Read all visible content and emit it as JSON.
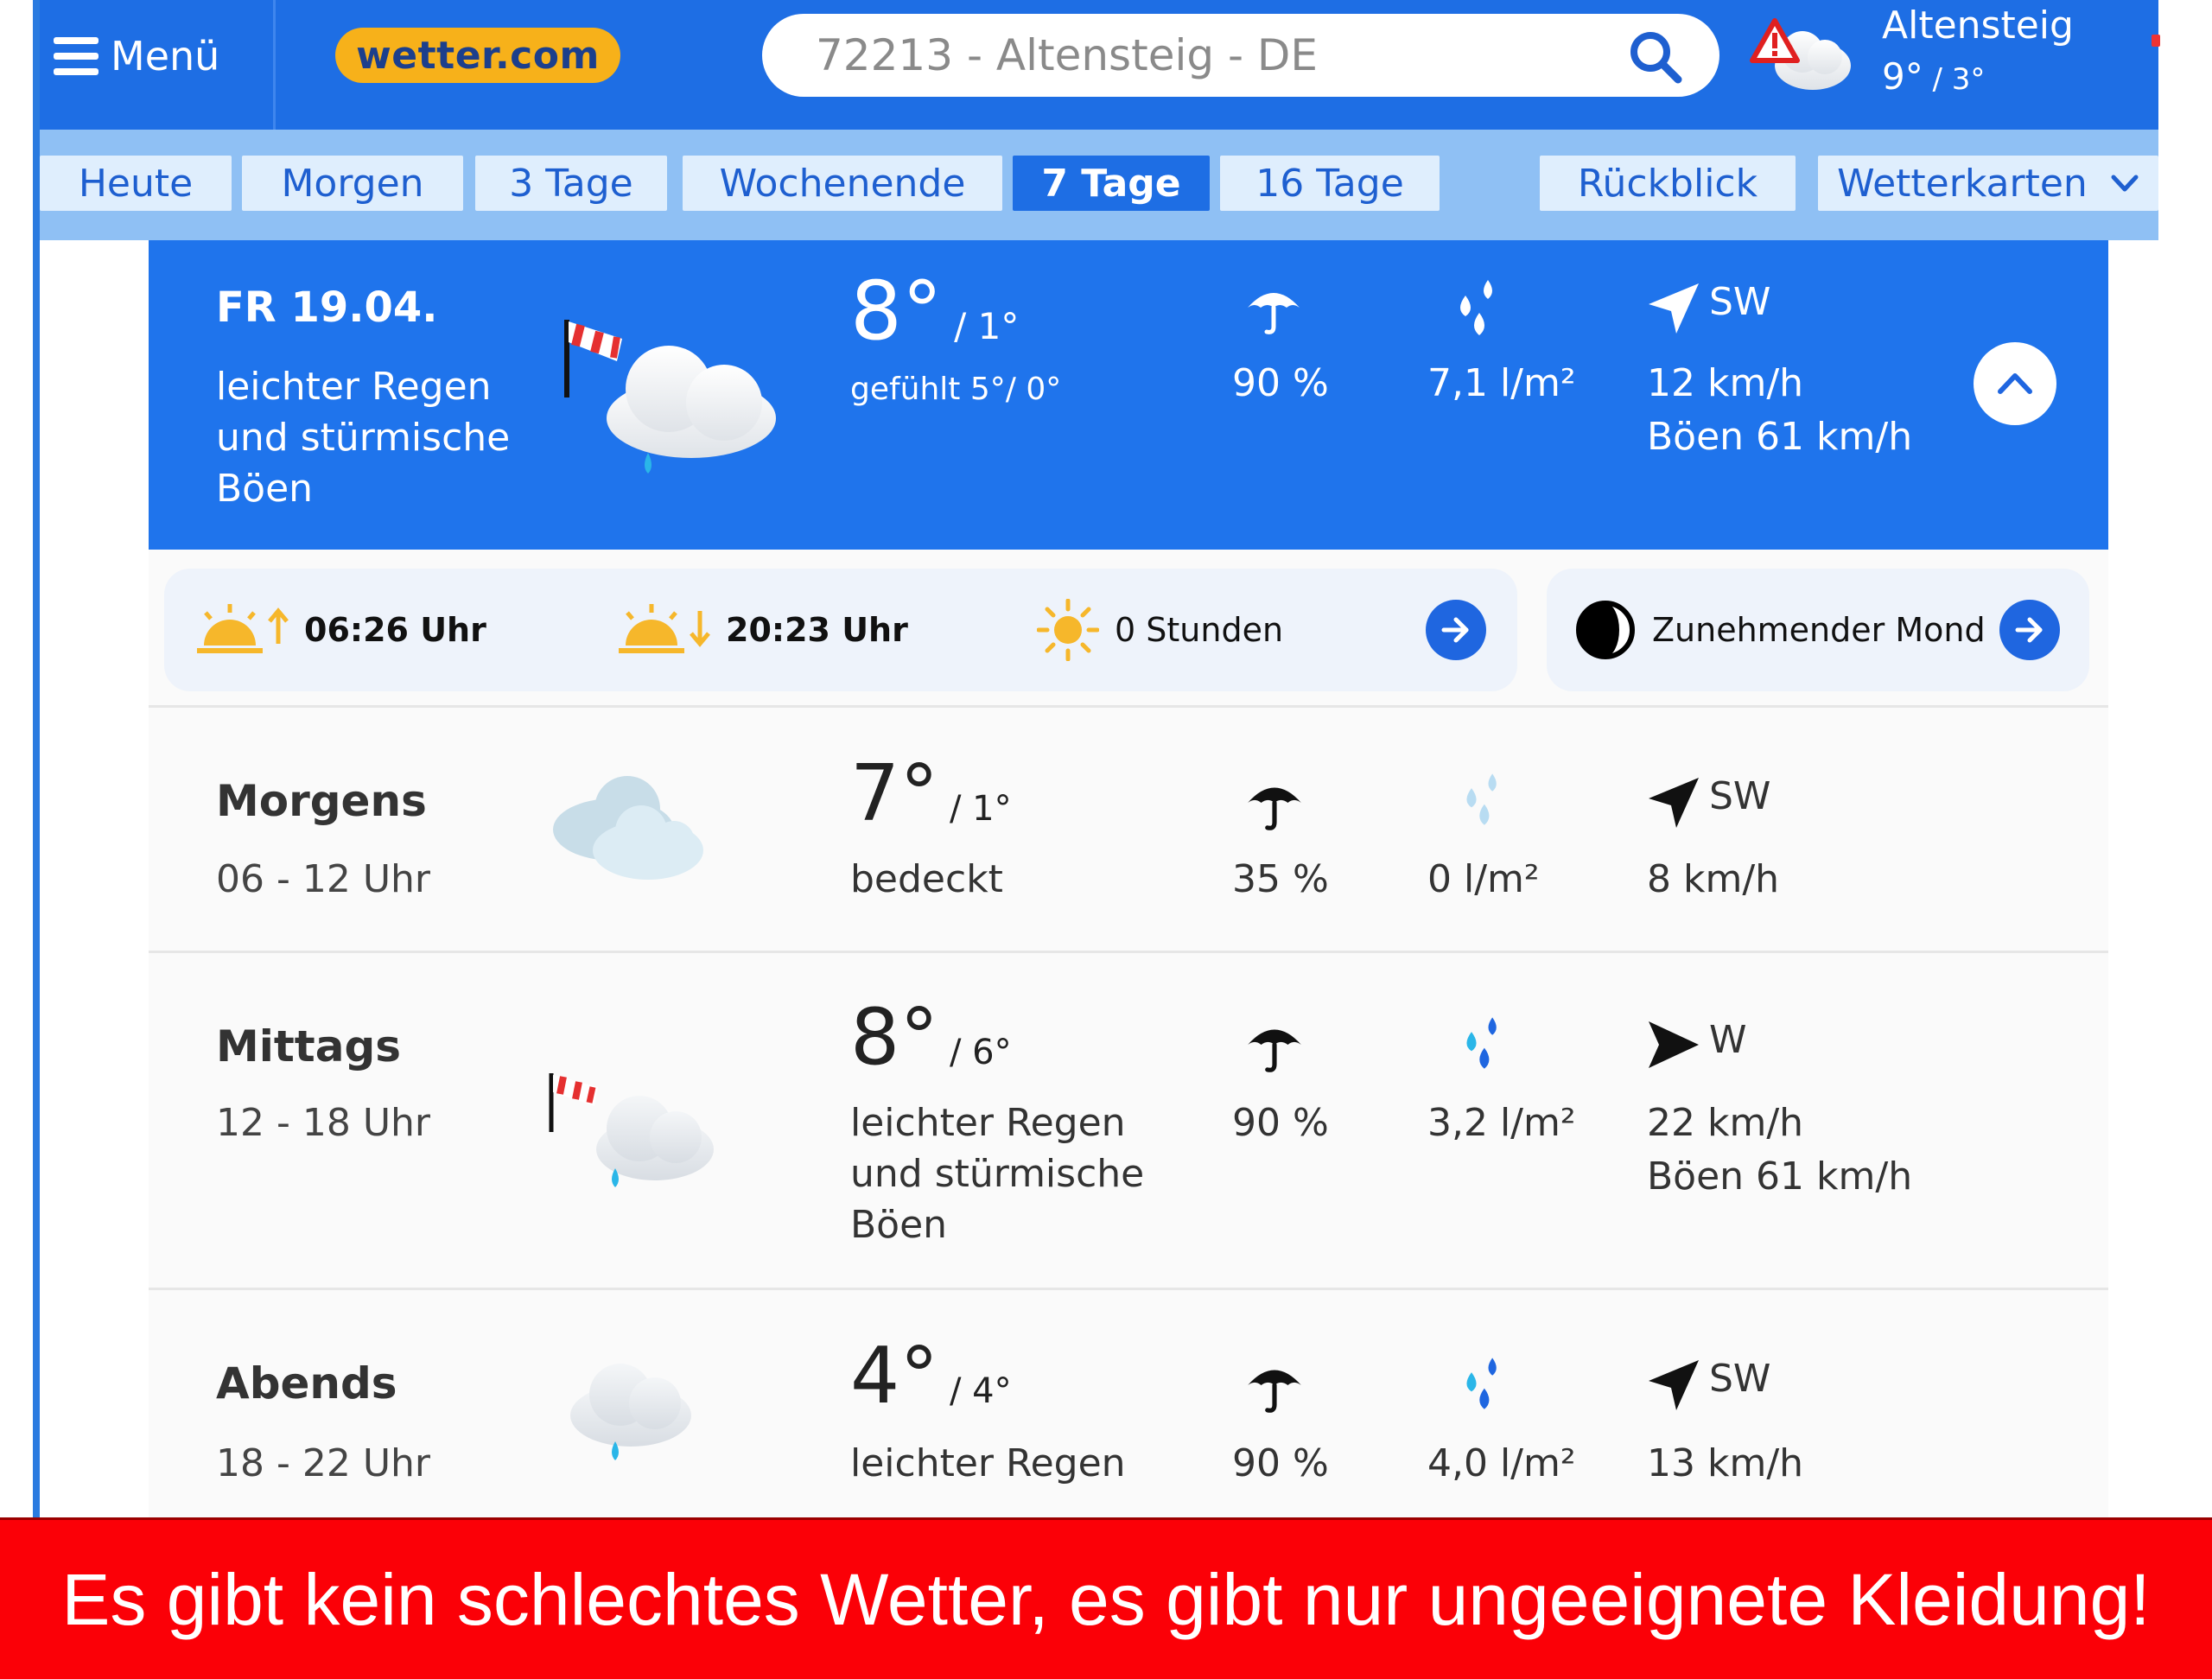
{
  "header": {
    "menu_label": "Menü",
    "logo_text": "wetter.com",
    "search_value": "72213 - Altensteig - DE",
    "location_city": "Altensteig",
    "location_temp_high": "9°",
    "location_temp_low": " / 3°"
  },
  "tabs": [
    {
      "label": "Heute"
    },
    {
      "label": "Morgen"
    },
    {
      "label": "3 Tage"
    },
    {
      "label": "Wochenende"
    },
    {
      "label": "7 Tage",
      "active": true
    },
    {
      "label": "16 Tage"
    },
    {
      "label": "Rückblick"
    },
    {
      "label": "Wetterkarten"
    }
  ],
  "day": {
    "date": "FR 19.04.",
    "condition": "leichter Regen und stürmische Böen",
    "temp_high": "8°",
    "temp_low": " / 1°",
    "feels_like": "gefühlt 5°/ 0°",
    "precip_probability": "90 %",
    "precip_amount": "7,1 l/m²",
    "wind_direction": "SW",
    "wind_speed": "12 km/h",
    "wind_gusts": "Böen 61 km/h"
  },
  "sun_moon": {
    "sunrise": "06:26 Uhr",
    "sunset": "20:23 Uhr",
    "sunshine": "0 Stunden",
    "moon_phase": "Zunehmender Mond"
  },
  "periods": [
    {
      "name": "Morgens",
      "time": "06 - 12 Uhr",
      "temp_high": "7°",
      "temp_low": " / 1°",
      "condition": "bedeckt",
      "precip_probability": "35 %",
      "precip_amount": "0 l/m²",
      "wind_direction": "SW",
      "wind_speed": "8 km/h",
      "wind_gusts": ""
    },
    {
      "name": "Mittags",
      "time": "12 - 18 Uhr",
      "temp_high": "8°",
      "temp_low": " / 6°",
      "condition": "leichter Regen und stürmische Böen",
      "precip_probability": "90 %",
      "precip_amount": "3,2 l/m²",
      "wind_direction": "W",
      "wind_speed": "22 km/h",
      "wind_gusts": "Böen 61 km/h"
    },
    {
      "name": "Abends",
      "time": "18 - 22 Uhr",
      "temp_high": "4°",
      "temp_low": " / 4°",
      "condition": "leichter Regen",
      "precip_probability": "90 %",
      "precip_amount": "4,0 l/m²",
      "wind_direction": "SW",
      "wind_speed": "13 km/h",
      "wind_gusts": ""
    }
  ],
  "caption": "Es gibt kein schlechtes Wetter, es gibt nur ungeeignete Kleidung!",
  "colors": {
    "brand_blue": "#1e6ee4",
    "logo_yellow": "#f7b11a",
    "banner_red": "#fb0007"
  }
}
